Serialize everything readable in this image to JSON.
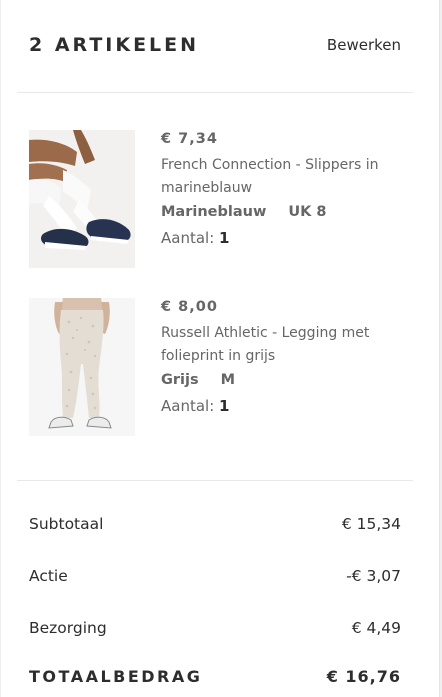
{
  "header": {
    "title": "2 ARTIKELEN",
    "edit_label": "Bewerken"
  },
  "items": [
    {
      "price": "€ 7,34",
      "name": "French Connection - Slippers in marineblauw",
      "color": "Marineblauw",
      "size": "UK 8",
      "qty_label": "Aantal:",
      "qty": "1",
      "image": "navy-slippers-photo"
    },
    {
      "price": "€ 8,00",
      "name": "Russell Athletic - Legging met folieprint in grijs",
      "color": "Grijs",
      "size": "M",
      "qty_label": "Aantal:",
      "qty": "1",
      "image": "grey-leggings-photo"
    }
  ],
  "summary": {
    "subtotal_label": "Subtotaal",
    "subtotal_value": "€ 15,34",
    "discount_label": "Actie",
    "discount_value": "-€ 3,07",
    "delivery_label": "Bezorging",
    "delivery_value": "€ 4,49",
    "total_label": "TOTAALBEDRAG",
    "total_value": "€ 16,76"
  }
}
